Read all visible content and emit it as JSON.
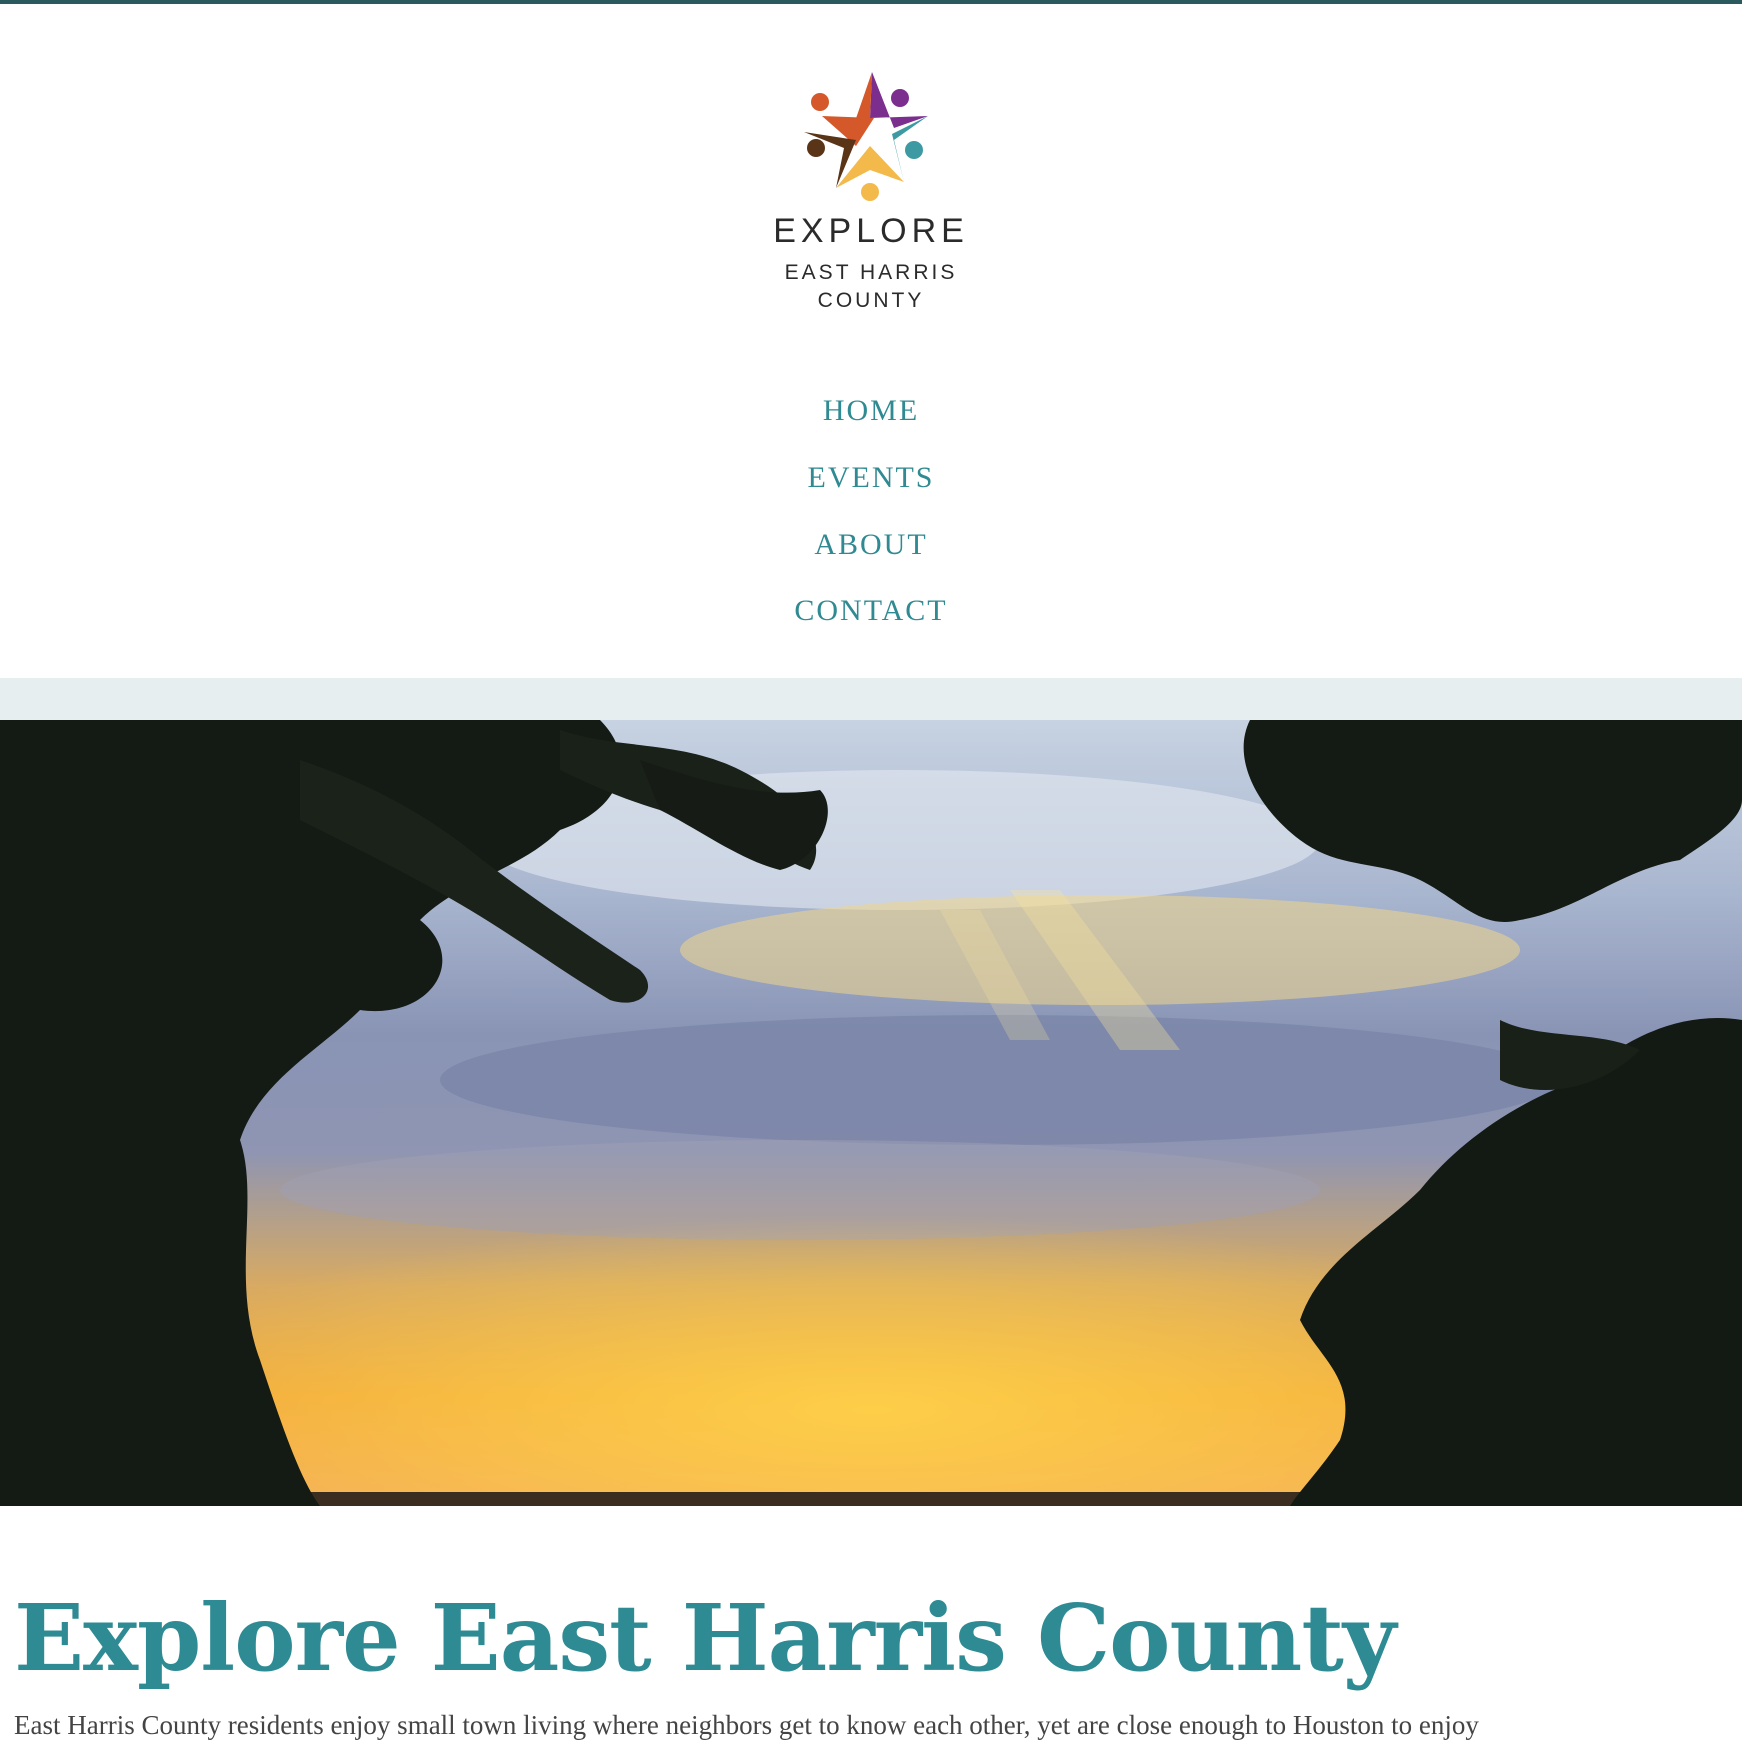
{
  "colors": {
    "accent": "#2f8a92",
    "title": "#2e8b94",
    "top_bar": "#2a5a5e",
    "strip": "#e6eef0",
    "body_text": "#444444",
    "logo_orange": "#d4582a",
    "logo_purple": "#7b2e8e",
    "logo_brown": "#5a3417",
    "logo_teal": "#3e9aa2",
    "logo_yellow": "#f3b94a"
  },
  "logo": {
    "icon": "star-people-logo-icon",
    "line1": "EXPLORE",
    "line2": "EAST HARRIS",
    "line3": "COUNTY"
  },
  "nav": {
    "items": [
      {
        "label": "HOME"
      },
      {
        "label": "EVENTS"
      },
      {
        "label": "ABOUT"
      },
      {
        "label": "CONTACT"
      }
    ]
  },
  "hero": {
    "image": "sunset-sky-with-trees-image"
  },
  "main": {
    "title": "Explore East Harris County",
    "intro": "East Harris County residents enjoy small town living where neighbors get to know each other, yet are close enough to Houston to enjoy"
  }
}
